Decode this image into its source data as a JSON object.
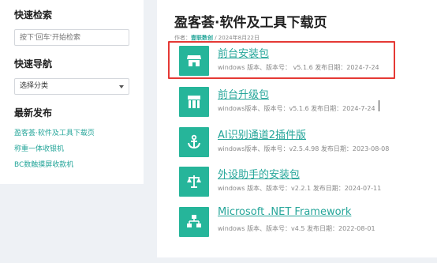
{
  "sidebar": {
    "search_heading": "快速检索",
    "search_placeholder": "按下'回车'开始检索",
    "nav_heading": "快速导航",
    "category_select": "选择分类",
    "recent_heading": "最新发布",
    "recent_links": [
      "盈客荟·软件及工具下载页",
      "称重一体收银机",
      "BC数触摸屏收款机"
    ]
  },
  "main": {
    "title": "盈客荟·软件及工具下载页",
    "meta_prefix": "作者：",
    "author": "壹联数创",
    "date": " / 2024年8月22日",
    "items": [
      {
        "title": "前台安装包",
        "info": "windows 版本、版本号： v5.1.6 发布日期：2024-7-24",
        "icon": "store-icon"
      },
      {
        "title": "前台升级包",
        "info": "windows版本、版本号：v5.1.6 发布日期：2024-7-24",
        "icon": "store-front-icon"
      },
      {
        "title": "AI识别通道2插件版",
        "info": "windows版本、版本号：v2.5.4.98 发布日期：2023-08-08",
        "icon": "anchor-icon"
      },
      {
        "title": "外设助手的安装包",
        "info": "windows 版本、版本号：v2.2.1 发布日期：2024-07-11",
        "icon": "scale-icon"
      },
      {
        "title": "Microsoft .NET Framework",
        "info": "windows 版本、版本号：v4.5 发布日期：2022-08-01",
        "icon": "sitemap-icon"
      }
    ]
  },
  "colors": {
    "accent": "#26a69a",
    "icon_bg": "#26b59a",
    "highlight": "#e53935"
  }
}
